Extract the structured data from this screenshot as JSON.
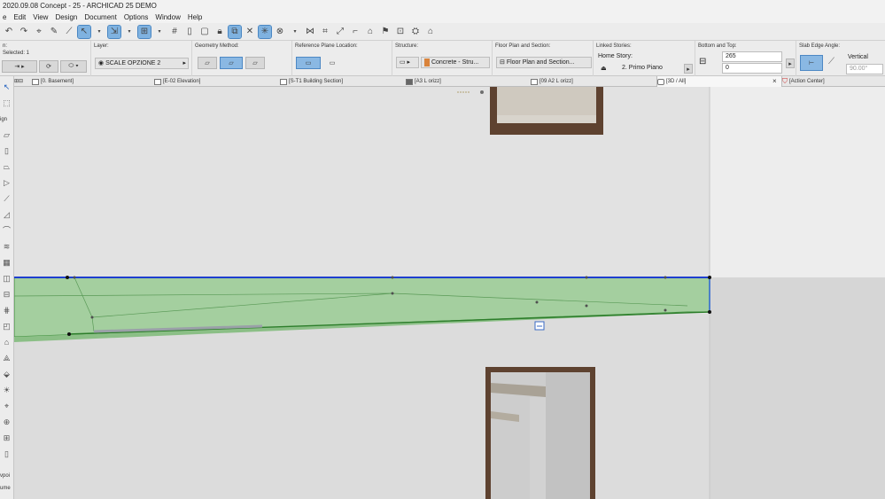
{
  "window": {
    "title": "2020.09.08 Concept - 25 - ARCHICAD 25 DEMO"
  },
  "menu": [
    "e",
    "Edit",
    "View",
    "Design",
    "Document",
    "Options",
    "Window",
    "Help"
  ],
  "infobox": {
    "left_label": "n:",
    "selected_label": "Selected: 1",
    "layer": {
      "title": "Layer:",
      "value": "SCALE OPZIONE 2"
    },
    "geometry": {
      "title": "Geometry Method:"
    },
    "refplane": {
      "title": "Reference Plane Location:"
    },
    "structure": {
      "title": "Structure:",
      "value": "Concrete - Stru..."
    },
    "floorplan": {
      "title": "Floor Plan and Section:",
      "value": "Floor Plan and Section..."
    },
    "linked": {
      "title": "Linked Stories:",
      "home_label": "Home Story:",
      "home_value": "2. Primo Piano"
    },
    "bottomtop": {
      "title": "Bottom and Top:",
      "top_value": "265",
      "bottom_value": "0"
    },
    "edge": {
      "title": "Slab Edge Angle:",
      "mode": "Vertical",
      "angle": "90.00°"
    }
  },
  "tabs": [
    {
      "label": "[0. Basement]",
      "active": false
    },
    {
      "label": "[E-02 Elevation]",
      "active": false
    },
    {
      "label": "[S-T1 Building Section]",
      "active": false
    },
    {
      "label": "[A3 L orizz]",
      "active": false
    },
    {
      "label": "[09 A2 L orizz]",
      "active": false
    },
    {
      "label": "[3D / All]",
      "active": true
    },
    {
      "label": "[Action Center]",
      "active": false
    }
  ],
  "tab_close": "×",
  "toolbox": {
    "label_top": "ign",
    "label_viewpoint": "vpoi",
    "label_volume": "ume"
  },
  "viewport": {
    "selection_color": "#1f3fcf",
    "slab_fill": "#9cc99a",
    "wall_color": "#e3e3e3",
    "frame_color": "#5a3e2c"
  }
}
